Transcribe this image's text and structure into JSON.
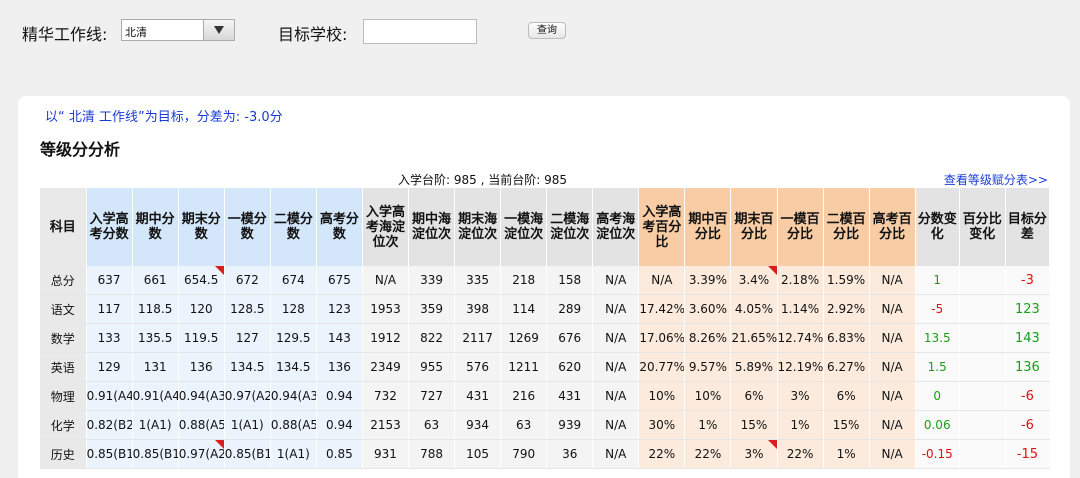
{
  "toolbar": {
    "workline_label": "精华工作线:",
    "workline_value": "北清",
    "target_school_label": "目标学校:",
    "target_school_value": "",
    "query_label": "查询"
  },
  "summary": {
    "target_text": "以“ 北清 工作线”为目标，分差为: -3.0分",
    "section_title": "等级分分析",
    "level_info": "入学台阶: 985 , 当前台阶: 985",
    "view_link": "查看等级赋分表>>"
  },
  "colors": {
    "score_header": "#d3e6fa",
    "percentile_header": "#f8cda6",
    "positive": "#1a9e1a",
    "negative": "#e01010",
    "link": "#1a3cd6"
  },
  "table": {
    "headers": [
      "科目",
      "入学高考分数",
      "期中分数",
      "期末分数",
      "一模分数",
      "二模分数",
      "高考分数",
      "入学高考海淀位次",
      "期中海淀位次",
      "期末海淀位次",
      "一模海淀位次",
      "二模海淀位次",
      "高考海淀位次",
      "入学高考百分比",
      "期中百分比",
      "期末百分比",
      "一模百分比",
      "二模百分比",
      "高考百分比",
      "分数变化",
      "百分比变化",
      "目标分差"
    ],
    "rows": [
      [
        "总分",
        "637",
        "661",
        "654.5",
        "672",
        "674",
        "675",
        "N/A",
        "339",
        "335",
        "218",
        "158",
        "N/A",
        "N/A",
        "3.39%",
        "3.4%",
        "2.18%",
        "1.59%",
        "N/A",
        "1",
        "",
        "-3"
      ],
      [
        "语文",
        "117",
        "118.5",
        "120",
        "128.5",
        "128",
        "123",
        "1953",
        "359",
        "398",
        "114",
        "289",
        "N/A",
        "17.42%",
        "3.60%",
        "4.05%",
        "1.14%",
        "2.92%",
        "N/A",
        "-5",
        "",
        "123"
      ],
      [
        "数学",
        "133",
        "135.5",
        "119.5",
        "127",
        "129.5",
        "143",
        "1912",
        "822",
        "2117",
        "1269",
        "676",
        "N/A",
        "17.06%",
        "8.26%",
        "21.65%",
        "12.74%",
        "6.83%",
        "N/A",
        "13.5",
        "",
        "143"
      ],
      [
        "英语",
        "129",
        "131",
        "136",
        "134.5",
        "134.5",
        "136",
        "2349",
        "955",
        "576",
        "1211",
        "620",
        "N/A",
        "20.77%",
        "9.57%",
        "5.89%",
        "12.19%",
        "6.27%",
        "N/A",
        "1.5",
        "",
        "136"
      ],
      [
        "物理",
        "0.91(A4)",
        "0.91(A4)",
        "0.94(A3)",
        "0.97(A2)",
        "0.94(A3)",
        "0.94",
        "732",
        "727",
        "431",
        "216",
        "431",
        "N/A",
        "10%",
        "10%",
        "6%",
        "3%",
        "6%",
        "N/A",
        "0",
        "",
        "-6"
      ],
      [
        "化学",
        "0.82(B2)",
        "1(A1)",
        "0.88(A5)",
        "1(A1)",
        "0.88(A5)",
        "0.94",
        "2153",
        "63",
        "934",
        "63",
        "939",
        "N/A",
        "30%",
        "1%",
        "15%",
        "1%",
        "15%",
        "N/A",
        "0.06",
        "",
        "-6"
      ],
      [
        "历史",
        "0.85(B1)",
        "0.85(B1)",
        "0.97(A2)",
        "0.85(B1)",
        "1(A1)",
        "0.85",
        "931",
        "788",
        "105",
        "790",
        "36",
        "N/A",
        "22%",
        "22%",
        "3%",
        "22%",
        "1%",
        "N/A",
        "-0.15",
        "",
        "-15"
      ]
    ]
  }
}
